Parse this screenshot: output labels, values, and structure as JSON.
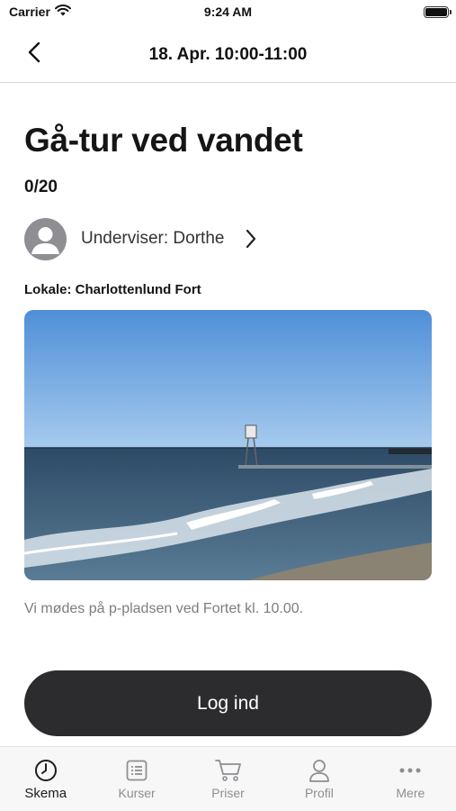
{
  "status_bar": {
    "carrier": "Carrier",
    "time": "9:24 AM",
    "icons": [
      "wifi-icon",
      "battery-icon"
    ]
  },
  "nav": {
    "title": "18. Apr. 10:00-11:00",
    "back_icon": "chevron-left-icon"
  },
  "class": {
    "title": "Gå-tur ved vandet",
    "capacity": "0/20",
    "instructor_label": "Underviser: Dorthe",
    "location": "Lokale: Charlottenlund Fort",
    "description": "Vi mødes på p-pladsen ved Fortet kl. 10.00."
  },
  "actions": {
    "login_label": "Log ind"
  },
  "tabs": [
    {
      "label": "Skema",
      "icon": "clock-icon",
      "active": true
    },
    {
      "label": "Kurser",
      "icon": "list-icon",
      "active": false
    },
    {
      "label": "Priser",
      "icon": "cart-icon",
      "active": false
    },
    {
      "label": "Profil",
      "icon": "person-icon",
      "active": false
    },
    {
      "label": "Mere",
      "icon": "more-dots-icon",
      "active": false
    }
  ],
  "colors": {
    "button_bg": "#2c2c2e",
    "text_primary": "#151515",
    "text_secondary": "#7d7d80",
    "tab_inactive": "#8e8e93"
  }
}
